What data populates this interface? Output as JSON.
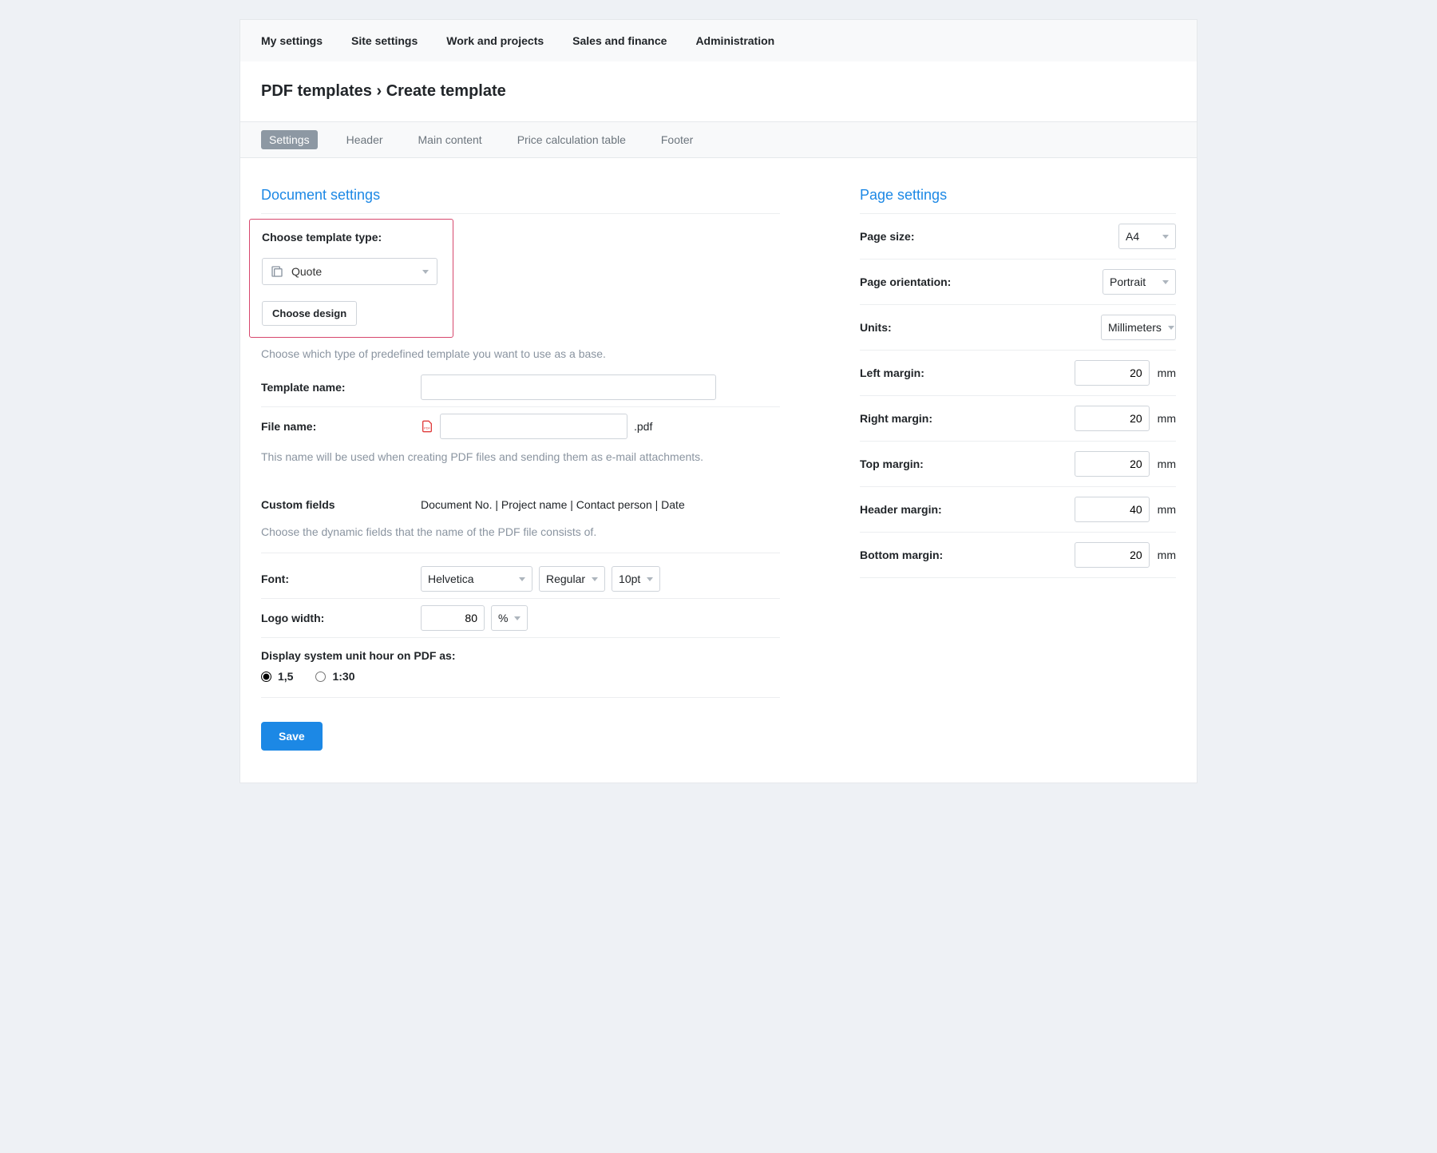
{
  "nav": {
    "items": [
      "My settings",
      "Site settings",
      "Work and projects",
      "Sales and finance",
      "Administration"
    ]
  },
  "breadcrumb": "PDF templates › Create template",
  "tabs": [
    "Settings",
    "Header",
    "Main content",
    "Price calculation table",
    "Footer"
  ],
  "left": {
    "section_title": "Document settings",
    "choose_type_label": "Choose template type:",
    "template_type_value": "Quote",
    "choose_design_btn": "Choose design",
    "choose_type_help": "Choose which type of predefined template you want to use as a base.",
    "template_name_label": "Template name:",
    "template_name_value": "",
    "file_name_label": "File name:",
    "file_name_value": "",
    "file_ext": ".pdf",
    "file_name_help": "This name will be used when creating PDF files and sending them as e-mail attachments.",
    "custom_fields_label": "Custom fields",
    "custom_fields_value": "Document No. | Project name | Contact person | Date",
    "custom_fields_help": "Choose the dynamic fields that the name of the PDF file consists of.",
    "font_label": "Font:",
    "font_family": "Helvetica",
    "font_weight": "Regular",
    "font_size": "10pt",
    "logo_width_label": "Logo width:",
    "logo_width_value": "80",
    "logo_width_unit": "%",
    "display_unit_label": "Display system unit hour on PDF as:",
    "radio_decimal": "1,5",
    "radio_time": "1:30",
    "save_btn": "Save"
  },
  "right": {
    "section_title": "Page settings",
    "page_size_label": "Page size:",
    "page_size_value": "A4",
    "orientation_label": "Page orientation:",
    "orientation_value": "Portrait",
    "units_label": "Units:",
    "units_value": "Millimeters",
    "left_margin_label": "Left margin:",
    "left_margin_value": "20",
    "right_margin_label": "Right margin:",
    "right_margin_value": "20",
    "top_margin_label": "Top margin:",
    "top_margin_value": "20",
    "header_margin_label": "Header margin:",
    "header_margin_value": "40",
    "bottom_margin_label": "Bottom margin:",
    "bottom_margin_value": "20",
    "unit_suffix": "mm"
  }
}
